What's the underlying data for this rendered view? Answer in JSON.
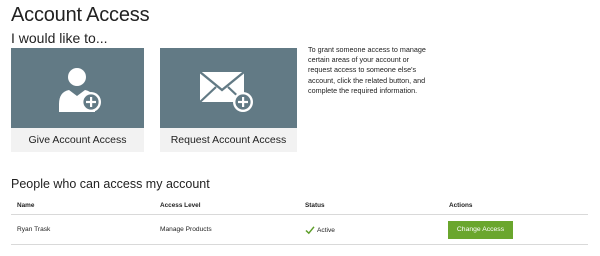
{
  "header": {
    "title": "Account Access",
    "subtitle": "I would like to..."
  },
  "cards": [
    {
      "label": "Give Account Access",
      "icon": "user-add-icon"
    },
    {
      "label": "Request Account Access",
      "icon": "envelope-add-icon"
    }
  ],
  "info_text": "To grant someone access to manage certain areas of your account or request access to someone else's account, click the related button, and complete the required information.",
  "people": {
    "section_title": "People who can access my account",
    "columns": [
      "Name",
      "Access Level",
      "Status",
      "Actions"
    ],
    "rows": [
      {
        "name": "Ryan Trask",
        "access_level": "Manage Products",
        "status": "Active",
        "action_label": "Change Access"
      }
    ]
  },
  "colors": {
    "card_art": "#627a85",
    "card_bg": "#f2f2f2",
    "action_button": "#6aa62d",
    "status_check": "#5e9e2a"
  }
}
